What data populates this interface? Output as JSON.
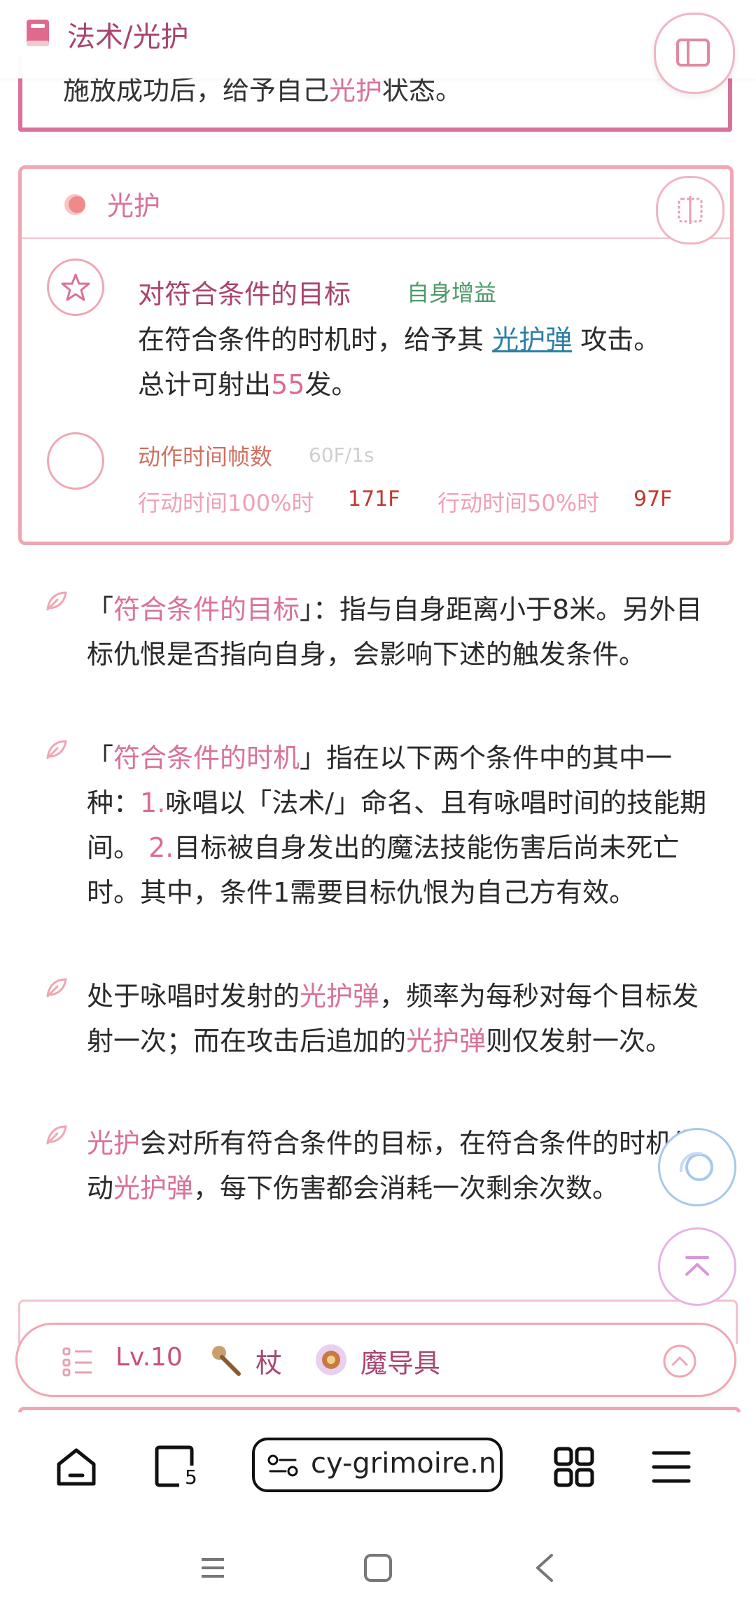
{
  "header": {
    "title": "法术/光护"
  },
  "prev_box": {
    "text_pre": "施放成功后，给予自己",
    "text_link": "光护",
    "text_post": "状态。"
  },
  "skill_card": {
    "title": "光护",
    "row1": {
      "title": "对符合条件的目标",
      "tag": "自身增益",
      "desc_pre": "在符合条件的时机时，给予其 ",
      "desc_link": "光护弹",
      "desc_mid": " 攻击。",
      "desc_line2_pre": "总计可射出",
      "desc_num": "55",
      "desc_line2_post": "发。"
    },
    "row2": {
      "title": "动作时间帧数",
      "sub": "60F/1s",
      "label1": "行动时间100%时",
      "value1": "171F",
      "label2": "行动时间50%时",
      "value2": "97F"
    }
  },
  "notes": [
    {
      "p1": "「",
      "hl1": "符合条件的目标",
      "p2": "」：指与自身距离小于8米。另外目标仇恨是否指向自身，会影响下述的触发条件。"
    },
    {
      "p1": "「",
      "hl1": "符合条件的时机",
      "p2": "」指在以下两个条件中的其中一种：",
      "n1": "1.",
      "p3": "咏唱以「法术/」命名、且有咏唱时间的技能期间。",
      "n2": "2.",
      "p4": "目标被自身发出的魔法技能伤害后尚未死亡时。其中，条件1需要目标仇恨为自己方有效。"
    },
    {
      "p1": "处于咏唱时发射的",
      "hl1": "光护弹",
      "p2": "，频率为每秒对每个目标发射一次；而在攻击后追加的",
      "hl2": "光护弹",
      "p3": "则仅发射一次。"
    },
    {
      "hl1": "光护",
      "p1": "会对所有符合条件的目标，在符合条件的时机发动",
      "hl2": "光护弹",
      "p2": "，每下伤害都会消耗一次剩余次数。"
    }
  ],
  "info_bar": {
    "level": "Lv.10",
    "weapon1": "杖",
    "weapon2": "魔导具"
  },
  "browser": {
    "url": "cy-grimoire.net",
    "tab_count": "5"
  },
  "colors": {
    "accent": "#d9729a",
    "border": "#f0a7b3",
    "title": "#a8456f"
  }
}
